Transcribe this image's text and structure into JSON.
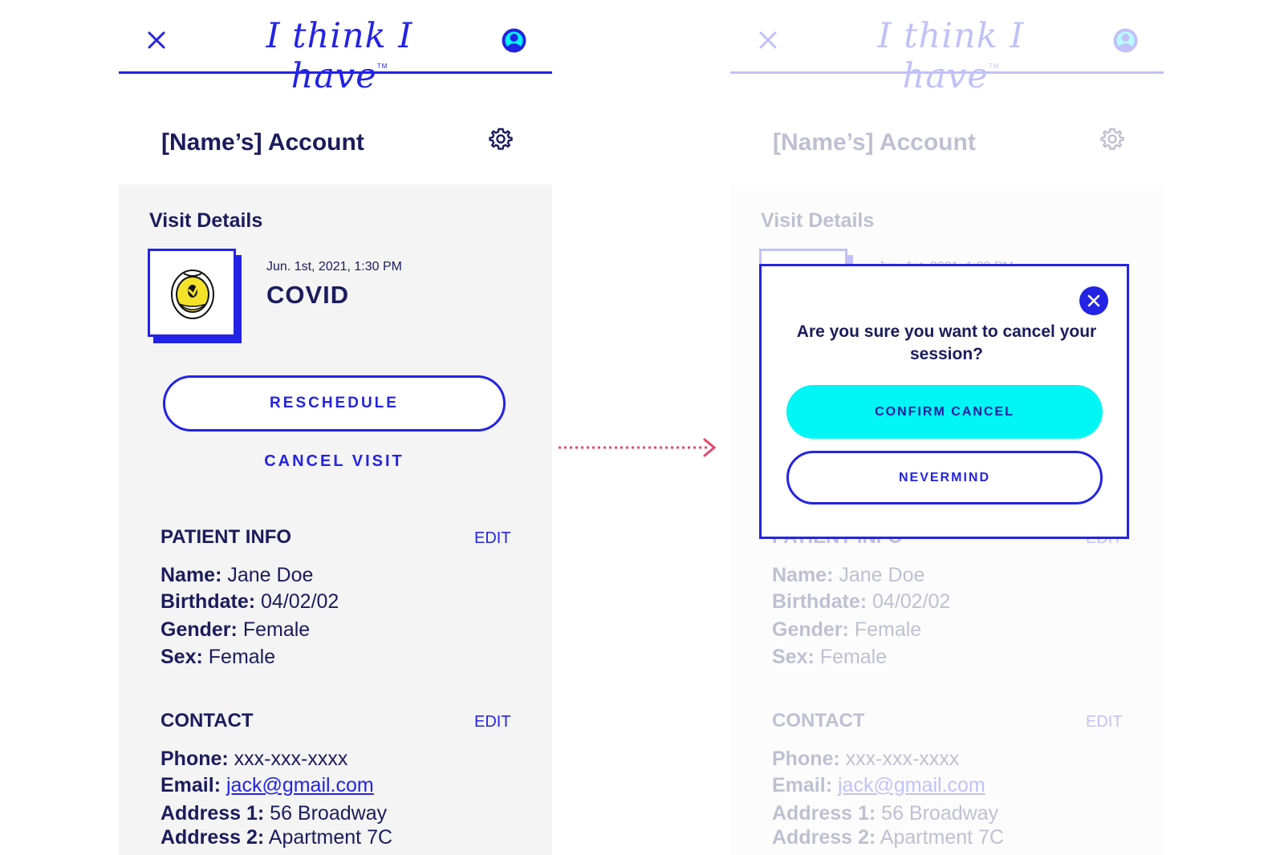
{
  "app": {
    "logo_text": "I think I have",
    "logo_tm": "TM"
  },
  "account": {
    "title": "[Name’s] Account"
  },
  "visit": {
    "heading": "Visit Details",
    "date": "Jun. 1st, 2021, 1:30 PM",
    "type": "COVID",
    "reschedule_label": "RESCHEDULE",
    "cancel_label": "CANCEL VISIT"
  },
  "patient": {
    "heading": "PATIENT INFO",
    "edit_label": "EDIT",
    "name_label": "Name:",
    "name": "Jane Doe",
    "birthdate_label": "Birthdate:",
    "birthdate": "04/02/02",
    "gender_label": "Gender:",
    "gender": "Female",
    "sex_label": "Sex:",
    "sex": "Female"
  },
  "contact": {
    "heading": "CONTACT",
    "edit_label": "EDIT",
    "phone_label": "Phone:",
    "phone": "xxx-xxx-xxxx",
    "email_label": "Email:",
    "email": "jack@gmail.com",
    "address1_label": "Address 1:",
    "address1": "56 Broadway",
    "address2_label": "Address 2:",
    "address2": "Apartment 7C"
  },
  "modal": {
    "question": "Are you sure you want to cancel your session?",
    "confirm_label": "CONFIRM CANCEL",
    "nevermind_label": "NEVERMIND"
  },
  "colors": {
    "accent": "#2323e6",
    "text_dark": "#1b1c5c",
    "confirm_fill": "#00f5f5",
    "arrow": "#e8456b",
    "panel_bg": "#f4f4f4"
  },
  "icons": [
    "close-icon",
    "user-avatar-icon",
    "gear-icon",
    "mouth-illustration-icon",
    "arrow-right-icon"
  ]
}
